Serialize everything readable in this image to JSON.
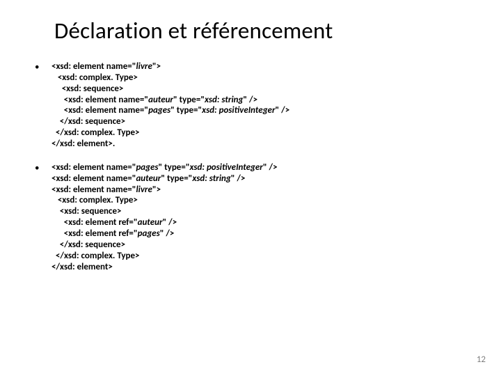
{
  "title": "Déclaration et référencement",
  "blocks": [
    {
      "lines": [
        [
          {
            "t": "<xsd: element name=\""
          },
          {
            "t": "livre",
            "i": true
          },
          {
            "t": "\">"
          }
        ],
        [
          {
            "t": "   <xsd: complex. Type>"
          }
        ],
        [
          {
            "t": "     <xsd: sequence>"
          }
        ],
        [
          {
            "t": "      <xsd: element name=\""
          },
          {
            "t": "auteur",
            "i": true
          },
          {
            "t": "\" type=\""
          },
          {
            "t": "xsd: string",
            "i": true
          },
          {
            "t": "\" />"
          }
        ],
        [
          {
            "t": "      <xsd: element name=\""
          },
          {
            "t": "pages",
            "i": true
          },
          {
            "t": "\" type=\""
          },
          {
            "t": "xsd: positiveInteger",
            "i": true
          },
          {
            "t": "\" />"
          }
        ],
        [
          {
            "t": "    </xsd: sequence>"
          }
        ],
        [
          {
            "t": "  </xsd: complex. Type>"
          }
        ],
        [
          {
            "t": "</xsd: element>."
          }
        ]
      ]
    },
    {
      "lines": [
        [
          {
            "t": "<xsd: element name=\""
          },
          {
            "t": "pages",
            "i": true
          },
          {
            "t": "\" type=\""
          },
          {
            "t": "xsd: positiveInteger",
            "i": true
          },
          {
            "t": "\" />"
          }
        ],
        [
          {
            "t": "<xsd: element name=\""
          },
          {
            "t": "auteur",
            "i": true
          },
          {
            "t": "\" type=\""
          },
          {
            "t": "xsd: string",
            "i": true
          },
          {
            "t": "\" />"
          }
        ],
        [
          {
            "t": "<xsd: element name=\""
          },
          {
            "t": "livre",
            "i": true
          },
          {
            "t": "\">"
          }
        ],
        [
          {
            "t": "   <xsd: complex. Type>"
          }
        ],
        [
          {
            "t": "    <xsd: sequence>"
          }
        ],
        [
          {
            "t": "      <xsd: element ref=\""
          },
          {
            "t": "auteur",
            "i": true
          },
          {
            "t": "\" />"
          }
        ],
        [
          {
            "t": "      <xsd: element ref=\""
          },
          {
            "t": "pages",
            "i": true
          },
          {
            "t": "\" />"
          }
        ],
        [
          {
            "t": "    </xsd: sequence>"
          }
        ],
        [
          {
            "t": "  </xsd: complex. Type>"
          }
        ],
        [
          {
            "t": "</xsd: element>"
          }
        ]
      ]
    }
  ],
  "page_number": "12"
}
